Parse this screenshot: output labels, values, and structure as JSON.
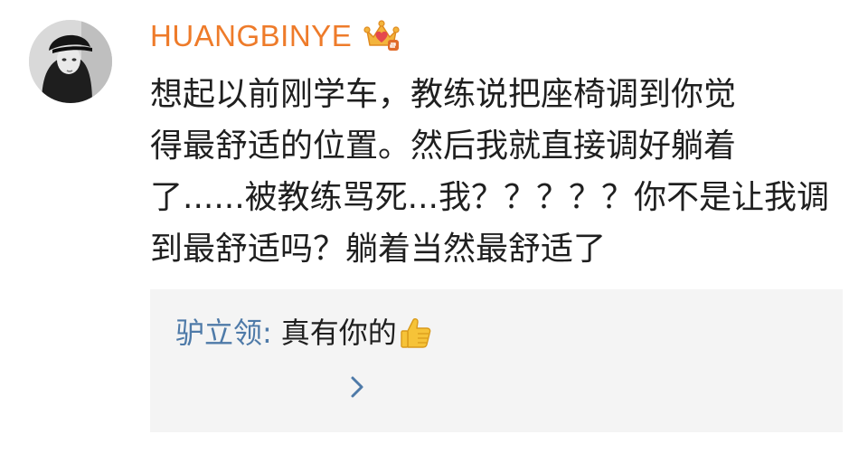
{
  "post": {
    "username": "HUANGBINYE",
    "badge_icon": "vip-crown-icon",
    "text": "想起以前刚学车，教练说把座椅调到你觉\n得最舒适的位置。然后我就直接调好躺着\n了......被教练骂死...我？？？？？你不是让我调\n到最舒适吗？躺着当然最舒适了"
  },
  "reply": {
    "author": "驴立领",
    "separator": ":",
    "text": "真有你的",
    "emoji_icon": "thumbs-up-icon",
    "expand_icon": "chevron-right-icon"
  },
  "colors": {
    "username": "#ee7b2a",
    "reply_author": "#4e7aa8",
    "reply_background": "#f4f4f4",
    "text": "#1f1f1f"
  }
}
